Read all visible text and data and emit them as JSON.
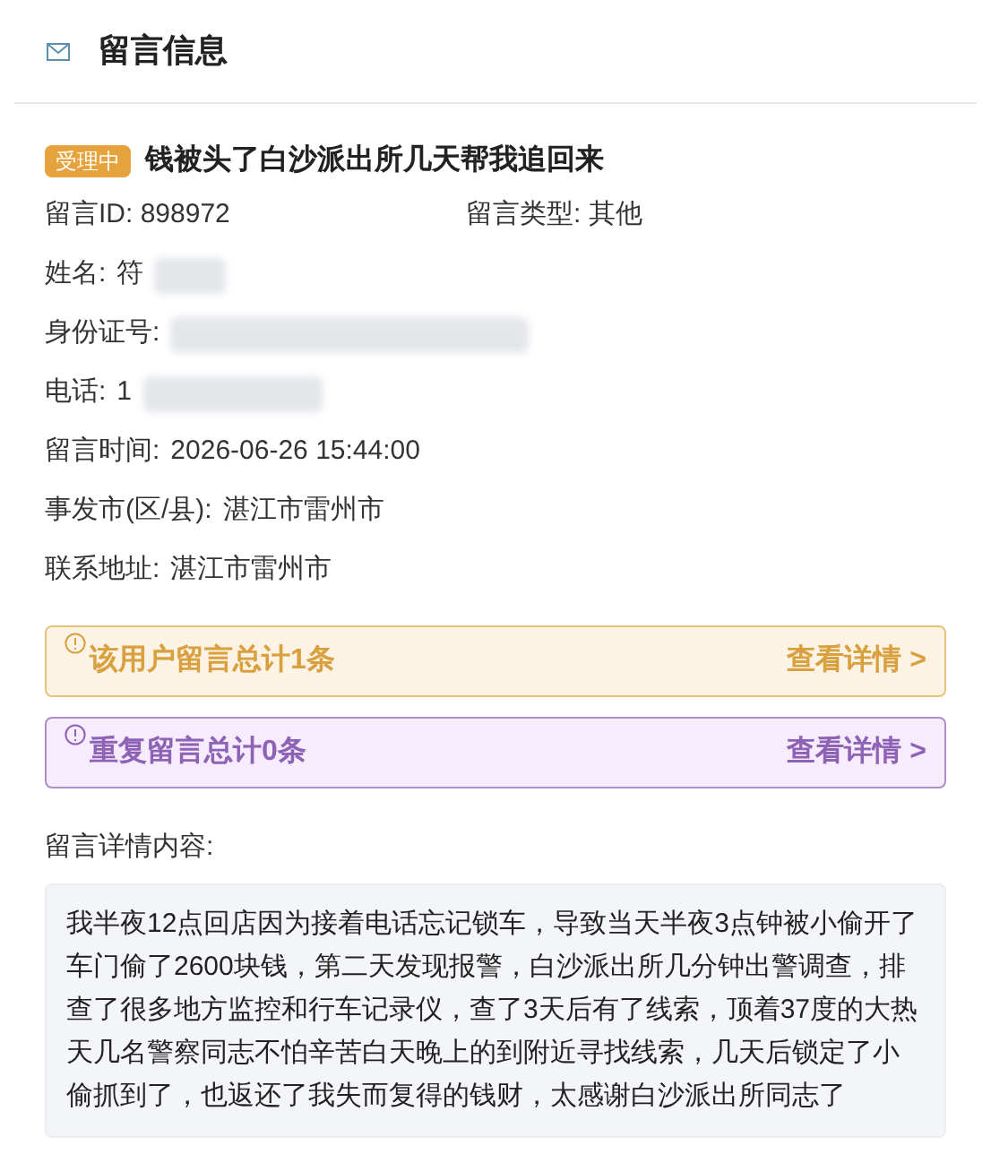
{
  "header": {
    "title": "留言信息"
  },
  "message": {
    "status": "受理中",
    "title": "钱被头了白沙派出所几天帮我追回来"
  },
  "fields": [
    {
      "label": "留言ID:",
      "value": "898972",
      "kind": "pair"
    },
    {
      "label": "留言类型:",
      "value": "其他",
      "kind": "pair"
    },
    {
      "label": "姓名:",
      "value": "符",
      "redacted": true,
      "kind": "row"
    },
    {
      "label": "身份证号:",
      "redacted": true,
      "kind": "row"
    },
    {
      "label": "电话:",
      "value": "1",
      "redacted": true,
      "kind": "row"
    },
    {
      "label": "留言时间:",
      "value": "2026-06-26 15:44:00",
      "redacted": false,
      "kind": "row"
    },
    {
      "label": "事发市(区/县):",
      "value": "湛江市雷州市",
      "redacted": false,
      "kind": "row"
    },
    {
      "label": "联系地址:",
      "value": "湛江市雷州市",
      "redacted": false,
      "kind": "row"
    }
  ],
  "notices": [
    {
      "text": "该用户留言总计1条",
      "link": "查看详情 >",
      "kind": "warning"
    },
    {
      "text": "重复留言总计0条",
      "link": "查看详情 >",
      "kind": "purple"
    }
  ],
  "details": {
    "label": "留言详情内容:",
    "text": "我半夜12点回店因为接着电话忘记锁车，导致当天半夜3点钟被小偷开了车门偷了2600块钱，第二天发现报警，白沙派出所几分钟出警调查，排查了很多地方监控和行车记录仪，查了3天后有了线索，顶着37度的大热天几名警察同志不怕辛苦白天晚上的到附近寻找线索，几天后锁定了小偷抓到了，也返还了我失而复得的钱财，太感谢白沙派出所同志了"
  }
}
